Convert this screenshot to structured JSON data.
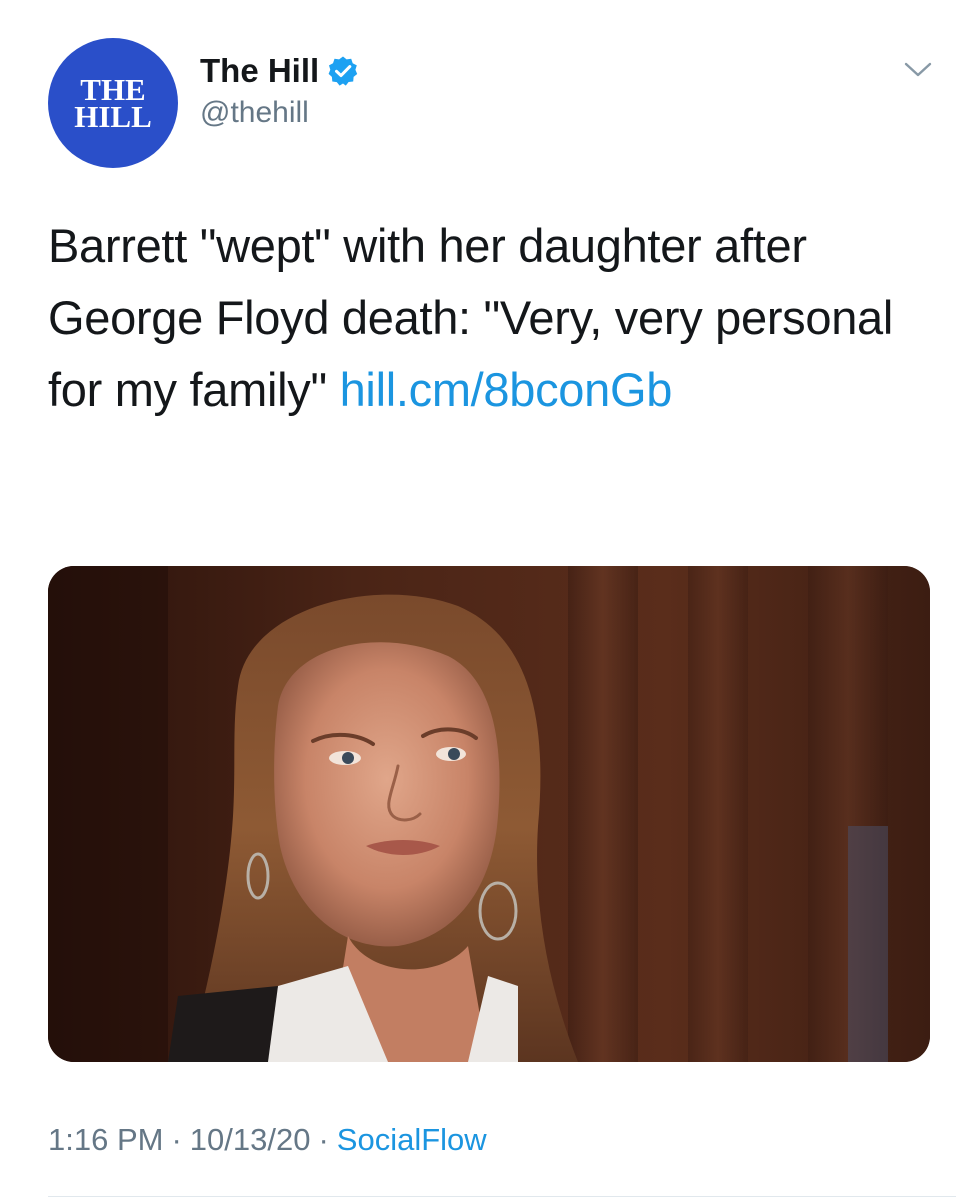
{
  "tweet": {
    "avatar": {
      "line1": "THE",
      "line2": "HILL",
      "color": "#2a4fc9"
    },
    "author": {
      "display_name": "The Hill",
      "handle": "@thehill",
      "verified": true,
      "verified_color": "#1da1f2"
    },
    "more_icon": "chevron-down-icon",
    "text": "Barrett \"wept\" with her daughter after George Floyd death: \"Very, very personal for my family\" ",
    "link": "hill.cm/8bconGb",
    "media": {
      "type": "photo"
    },
    "meta": {
      "time": "1:16 PM",
      "date": "10/13/20",
      "separator": "·",
      "source": "SocialFlow"
    },
    "colors": {
      "link": "#1b95e0",
      "secondary_text": "#657786",
      "primary_text": "#14171a"
    }
  }
}
